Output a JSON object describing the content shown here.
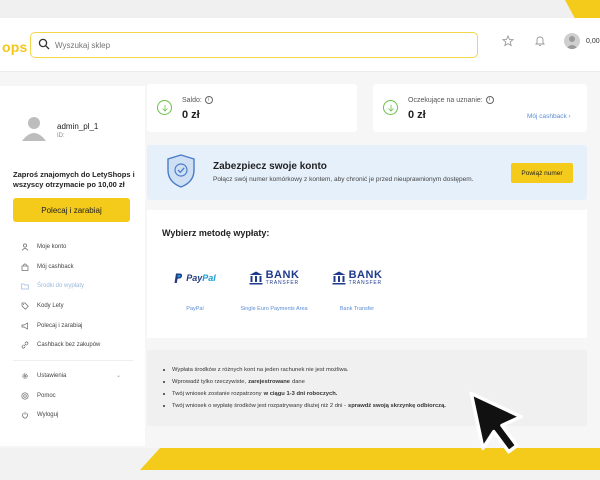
{
  "header": {
    "logo": "ops",
    "search_placeholder": "Wyszukaj sklep",
    "balance": "0,00"
  },
  "sidebar": {
    "username": "admin_pl_1",
    "id_label": "ID:",
    "invite_text": "Zaproś znajomych do LetyShops i wszyscy otrzymacie po 10,00 zł",
    "invite_button": "Polecaj i zarabiaj",
    "menu": [
      {
        "label": "Moje konto",
        "icon": "user-icon"
      },
      {
        "label": "Mój cashback",
        "icon": "bag-icon"
      },
      {
        "label": "Środki do wypłaty",
        "icon": "folder-icon",
        "active": true
      },
      {
        "label": "Kody Lety",
        "icon": "tag-icon"
      },
      {
        "label": "Polecaj i zarabiaj",
        "icon": "megaphone-icon"
      },
      {
        "label": "Cashback bez zakupów",
        "icon": "link-icon"
      }
    ],
    "menu2": [
      {
        "label": "Ustawienia",
        "icon": "gear-icon"
      },
      {
        "label": "Pomoc",
        "icon": "help-icon"
      },
      {
        "label": "Wyloguj",
        "icon": "logout-icon"
      }
    ]
  },
  "stats": {
    "saldo_label": "Saldo:",
    "saldo_value": "0 zł",
    "pending_label": "Oczekujące na uznanie:",
    "pending_value": "0 zł",
    "my_cashback_link": "Mój cashback"
  },
  "security": {
    "title": "Zabezpiecz swoje konto",
    "text": "Połącz swój numer komórkowy z kontem, aby chronić je przed nieuprawnionym dostępem.",
    "button": "Powiąż numer"
  },
  "methods": {
    "title": "Wybierz metodę wypłaty:",
    "items": [
      {
        "label": "PayPal",
        "logo_text": "PayPal"
      },
      {
        "label": "Single Euro Payments Area",
        "logo_big": "BANK",
        "logo_small": "TRANSFER"
      },
      {
        "label": "Bank Transfer",
        "logo_big": "BANK",
        "logo_small": "TRANSFER"
      }
    ]
  },
  "notes": {
    "n1": "Wypłata środków z różnych kont na jeden rachunek nie jest możliwa.",
    "n2_pre": "Wprowadź tylko rzeczywiste,",
    "n2_bold": "zarejestrowane",
    "n2_post": "dane",
    "n3_pre": "Twój wniosek zostanie rozpatrzony",
    "n3_bold": "w ciągu 1-3 dni roboczych.",
    "n4_pre": "Twój wniosek o wypłatę środków jest rozpatrywany dłużej niż 2 dni -",
    "n4_bold": "sprawdź swoją skrzynkę odbiorczą."
  },
  "colors": {
    "accent_yellow": "#f5cb1b",
    "link_blue": "#5b8ed6",
    "success_green": "#6cc04a",
    "paypal_dark": "#253b80",
    "paypal_light": "#179bd7",
    "bank_blue": "#1f3b8c"
  }
}
